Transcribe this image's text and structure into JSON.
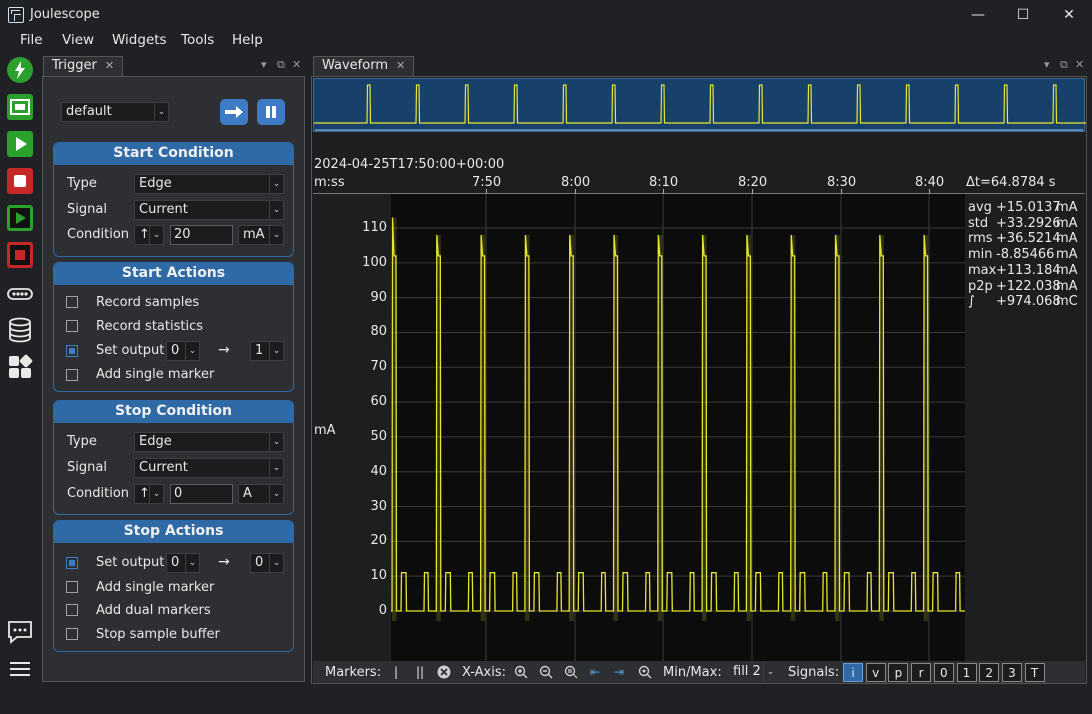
{
  "window": {
    "title": "Joulescope",
    "minimize": "—",
    "maximize": "☐",
    "close": "✕"
  },
  "menu": [
    "File",
    "View",
    "Widgets",
    "Tools",
    "Help"
  ],
  "rail_icons": [
    "power-icon",
    "device-icon",
    "play-icon",
    "stop-icon",
    "play-record-icon",
    "stop-record-icon",
    "dots-icon",
    "database-icon",
    "widgets-icon",
    "chat-icon",
    "hamburger-icon"
  ],
  "trigger": {
    "tab_label": "Trigger",
    "preset": "default",
    "start_condition": {
      "title": "Start Condition",
      "type_label": "Type",
      "type_value": "Edge",
      "signal_label": "Signal",
      "signal_value": "Current",
      "condition_label": "Condition",
      "edge": "↑",
      "value": "20",
      "unit": "mA"
    },
    "start_actions": {
      "title": "Start Actions",
      "items": [
        {
          "label": "Record samples",
          "checked": false
        },
        {
          "label": "Record statistics",
          "checked": false
        },
        {
          "label": "Set output",
          "checked": true,
          "from": "0",
          "to": "1"
        },
        {
          "label": "Add single marker",
          "checked": false
        }
      ]
    },
    "stop_condition": {
      "title": "Stop Condition",
      "type_label": "Type",
      "type_value": "Edge",
      "signal_label": "Signal",
      "signal_value": "Current",
      "condition_label": "Condition",
      "edge": "↑",
      "value": "0",
      "unit": "A"
    },
    "stop_actions": {
      "title": "Stop Actions",
      "items": [
        {
          "label": "Set output",
          "checked": true,
          "from": "0",
          "to": "0"
        },
        {
          "label": "Add single marker",
          "checked": false
        },
        {
          "label": "Add dual markers",
          "checked": false
        },
        {
          "label": "Stop sample buffer",
          "checked": false
        }
      ]
    },
    "arrow": "→"
  },
  "waveform": {
    "tab_label": "Waveform",
    "timestamp": "2024-04-25T17:50:00+00:00",
    "x_unit": "m:ss",
    "x_ticks": [
      "7:50",
      "8:00",
      "8:10",
      "8:20",
      "8:30",
      "8:40"
    ],
    "delta_t": "Δt=64.8784 s",
    "y_unit": "mA",
    "y_ticks": [
      "110",
      "100",
      "90",
      "80",
      "70",
      "60",
      "50",
      "40",
      "30",
      "20",
      "10",
      "0"
    ],
    "stats": [
      {
        "name": "avg",
        "value": "+15.0137",
        "unit": "mA"
      },
      {
        "name": "std",
        "value": "+33.2926",
        "unit": "mA"
      },
      {
        "name": "rms",
        "value": "+36.5214",
        "unit": "mA"
      },
      {
        "name": "min",
        "value": "-8.85466",
        "unit": "mA"
      },
      {
        "name": "max",
        "value": "+113.184",
        "unit": "mA"
      },
      {
        "name": "p2p",
        "value": "+122.038",
        "unit": "mA"
      },
      {
        "name": "∫",
        "value": "+974.068",
        "unit": "mC"
      }
    ],
    "trace_color": "#e6e62e"
  },
  "toolbar": {
    "markers_label": "Markers:",
    "xaxis_label": "X-Axis:",
    "minmax_label": "Min/Max:",
    "minmax_value": "fill 2",
    "signals_label": "Signals:",
    "signals": [
      "i",
      "v",
      "p",
      "r",
      "0",
      "1",
      "2",
      "3",
      "T"
    ]
  }
}
